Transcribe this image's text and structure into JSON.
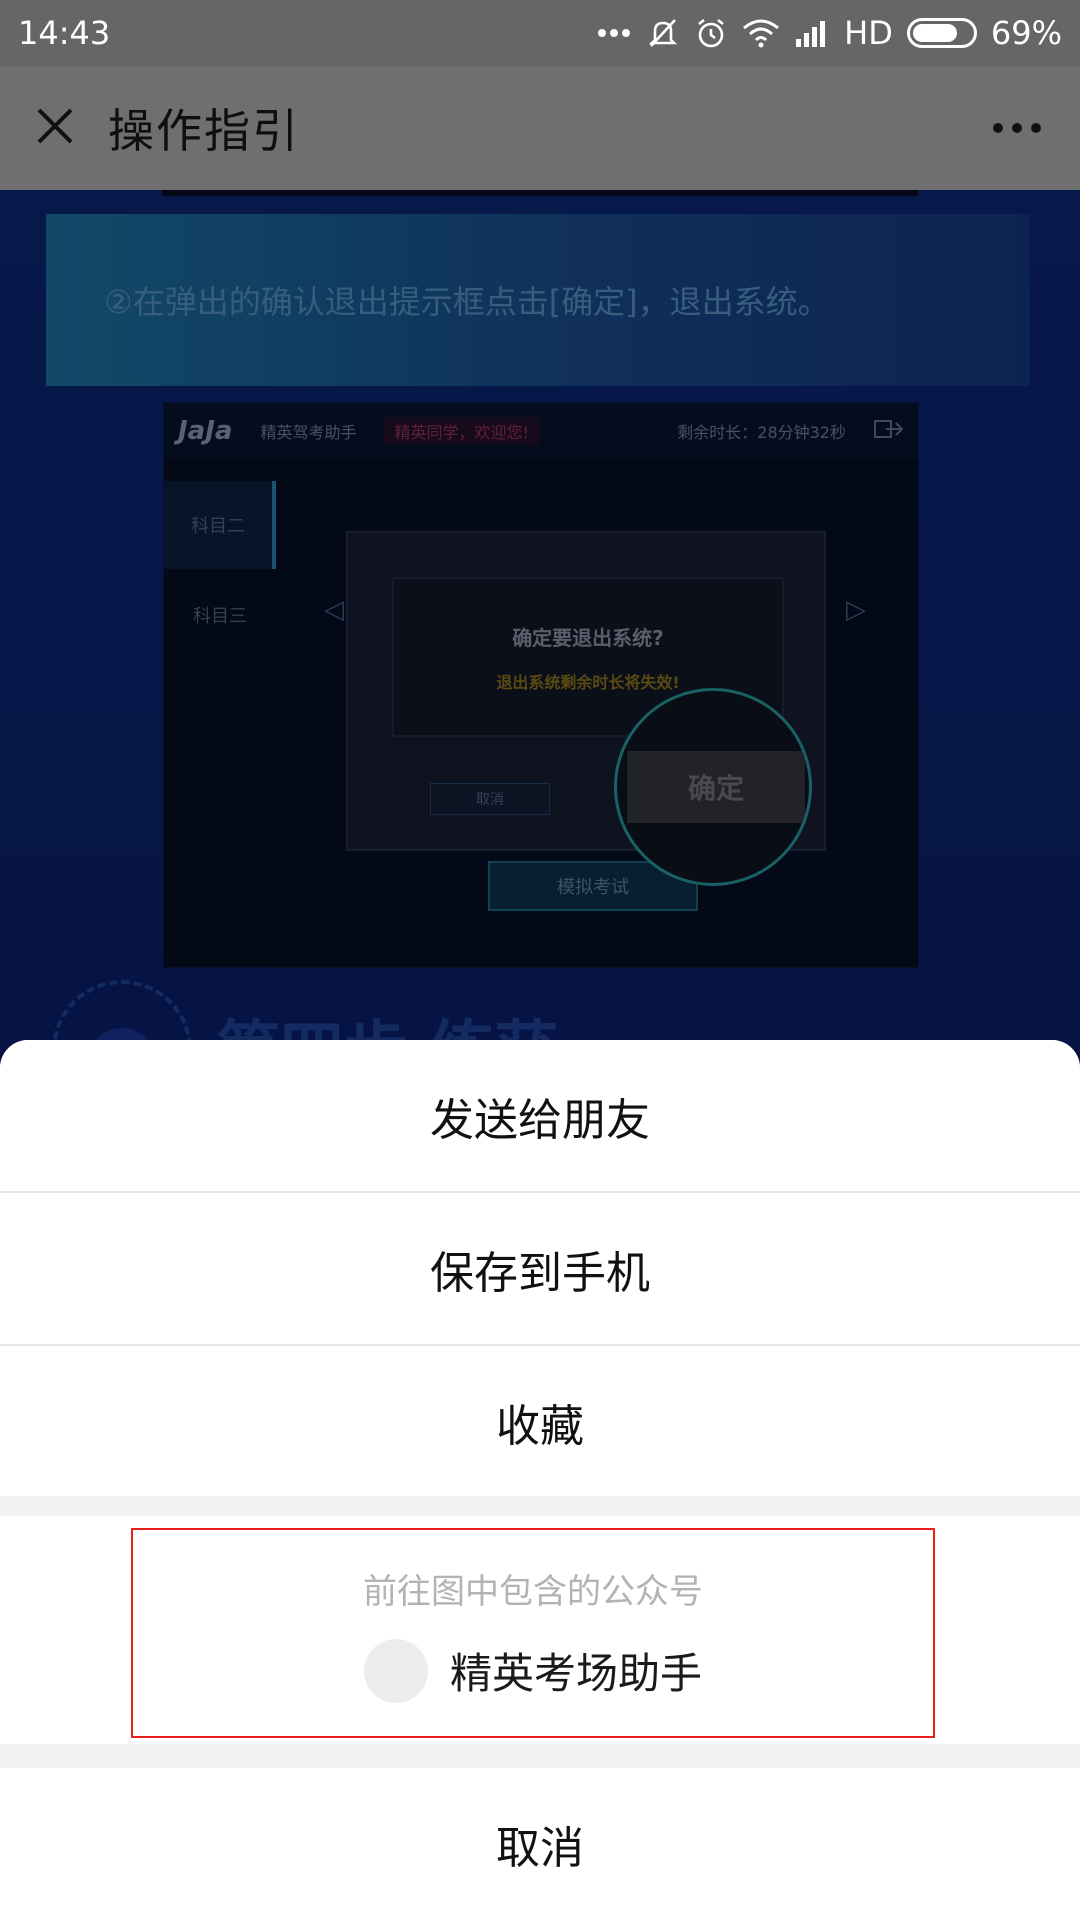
{
  "status_bar": {
    "time": "14:43",
    "network_label": "HD",
    "battery_percent": "69%",
    "icons": [
      "more-dots-icon",
      "mute-icon",
      "alarm-icon",
      "wifi-icon",
      "signal-icon",
      "battery-icon"
    ]
  },
  "title_bar": {
    "title": "操作指引",
    "close_icon": "close-icon",
    "more_icon": "more-icon"
  },
  "background": {
    "step_text": "②在弹出的确认退出提示框点击[确定]，退出系统。",
    "screenshot": {
      "logo": "JaJa",
      "app_name": "精英驾考助手",
      "welcome": "精英同学，欢迎您!",
      "time_left": "剩余时长：28分钟32秒",
      "tab_subject2": "科目二",
      "tab_subject3": "科目三",
      "dialog_question": "确定要退出系统?",
      "dialog_warning": "退出系统剩余时长将失效!",
      "dialog_cancel": "取消",
      "dialog_confirm": "确定",
      "sim_exam": "模拟考试"
    },
    "next_heading": "第四步  练获"
  },
  "action_sheet": {
    "send_to_friend": "发送给朋友",
    "save_to_phone": "保存到手机",
    "favorite": "收藏",
    "account_hint": "前往图中包含的公众号",
    "account_name": "精英考场助手",
    "cancel": "取消"
  }
}
